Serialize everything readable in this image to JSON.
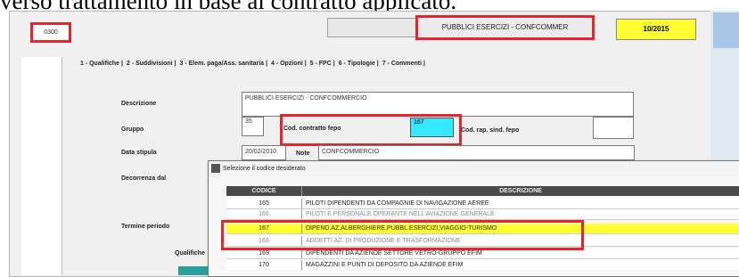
{
  "caption": "verso trattamento in base al contratto applicato.",
  "header": {
    "code": "0300",
    "title": "PUBBLICI ESERCIZI - CONFCOMMER",
    "date": "10/2015"
  },
  "tabs": [
    {
      "label": "1 - Qualifiche"
    },
    {
      "label": "2 - Suddivisioni"
    },
    {
      "label": "3 - Elem. paga/Ass. sanitaria"
    },
    {
      "label": "4 - Opzioni"
    },
    {
      "label": "5 - FPC"
    },
    {
      "label": "6 - Tipologie"
    },
    {
      "label": "7 - Commenti"
    }
  ],
  "form": {
    "descrizione_label": "Descrizione",
    "descrizione_value": "PUBBLICI ESERCIZI - CONFCOMMERCIO",
    "gruppo_label": "Gruppo",
    "gruppo_value": "35",
    "cod_contratto_label": "Cod. contratto fepo",
    "cod_contratto_value": "167",
    "cod_rap_label": "Cod. rap. sind. fepo",
    "data_stipula_label": "Data stipula",
    "data_stipula_value": "20/02/2010",
    "note_label": "Note",
    "note_value": "CONFCOMMERCIO",
    "decorrenza_label": "Decorrenza dal",
    "termine_label": "Termine periodo",
    "qualifiche_label": "Qualifiche"
  },
  "dialog": {
    "title": "Selezione il codice desiderato",
    "col_code": "CODICE",
    "col_desc": "DESCRIZIONE",
    "rows": [
      {
        "code": "165",
        "desc": "PILOTI DIPENDENTI DA COMPAGNIE DI NAVIGAZIONE AEREE"
      },
      {
        "code": "166",
        "desc": "PILOTI E PERSONALE OPERANTE NELL'AVIAZIONE GENERALE"
      },
      {
        "code": "167",
        "desc": "DIPEND.AZ.ALBERGHIERE,PUBBL.ESERCIZI,VIAGGIO-TURISMO"
      },
      {
        "code": "168",
        "desc": "ADDETTI AZ. DI PRODUZIONE E TRASFORMAZIONE"
      },
      {
        "code": "169",
        "desc": "DIPENDENTI DA AZIENDE SETTORE VETRO-GRUPPO EFIM"
      },
      {
        "code": "170",
        "desc": "MAGAZZINI E PUNTI DI DEPOSITO DA AZIENDE EFIM"
      }
    ]
  },
  "colors": {
    "highlight_row": "#ffff33",
    "red_box": "#e3262c",
    "cyan_field": "#33e8ff",
    "date_bg": "#ffff33"
  }
}
